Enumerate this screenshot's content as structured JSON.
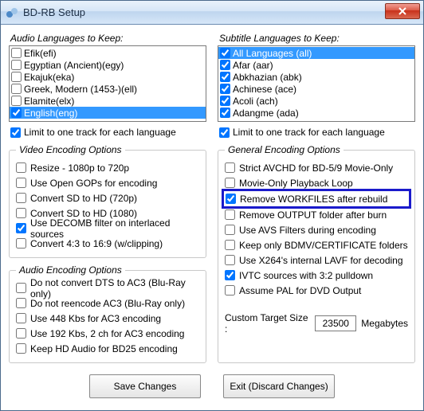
{
  "window": {
    "title": "BD-RB Setup"
  },
  "audio": {
    "section_label": "Audio Languages to Keep:",
    "items": [
      {
        "label": "Efik(efi)",
        "checked": false,
        "selected": false
      },
      {
        "label": "Egyptian (Ancient)(egy)",
        "checked": false,
        "selected": false
      },
      {
        "label": "Ekajuk(eka)",
        "checked": false,
        "selected": false
      },
      {
        "label": "Greek, Modern (1453-)(ell)",
        "checked": false,
        "selected": false
      },
      {
        "label": "Elamite(elx)",
        "checked": false,
        "selected": false
      },
      {
        "label": "English(eng)",
        "checked": true,
        "selected": true
      }
    ],
    "limit_label": "Limit to one track for each language",
    "limit_checked": true
  },
  "subtitle": {
    "section_label": "Subtitle Languages to Keep:",
    "items": [
      {
        "label": "All Languages (all)",
        "checked": true,
        "selected": true
      },
      {
        "label": "Afar (aar)",
        "checked": true,
        "selected": false
      },
      {
        "label": "Abkhazian (abk)",
        "checked": true,
        "selected": false
      },
      {
        "label": "Achinese (ace)",
        "checked": true,
        "selected": false
      },
      {
        "label": "Acoli (ach)",
        "checked": true,
        "selected": false
      },
      {
        "label": "Adangme (ada)",
        "checked": true,
        "selected": false
      }
    ],
    "limit_label": "Limit to one track for each language",
    "limit_checked": true
  },
  "video_opts": {
    "legend": "Video Encoding Options",
    "items": [
      {
        "label": "Resize  - 1080p to 720p",
        "checked": false
      },
      {
        "label": "Use Open GOPs for encoding",
        "checked": false
      },
      {
        "label": "Convert SD to HD (720p)",
        "checked": false
      },
      {
        "label": "Convert SD to HD (1080)",
        "checked": false
      },
      {
        "label": "Use DECOMB filter on interlaced sources",
        "checked": true
      },
      {
        "label": "Convert 4:3 to 16:9 (w/clipping)",
        "checked": false
      }
    ]
  },
  "audio_opts": {
    "legend": "Audio Encoding Options",
    "items": [
      {
        "label": "Do not convert DTS to AC3  (Blu-Ray only)",
        "checked": false
      },
      {
        "label": "Do not reencode AC3  (Blu-Ray only)",
        "checked": false
      },
      {
        "label": "Use 448 Kbs for AC3 encoding",
        "checked": false
      },
      {
        "label": "Use 192 Kbs, 2 ch for AC3 encoding",
        "checked": false
      },
      {
        "label": "Keep HD Audio for BD25 encoding",
        "checked": false
      }
    ]
  },
  "general_opts": {
    "legend": "General Encoding Options",
    "items": [
      {
        "label": "Strict AVCHD for BD-5/9 Movie-Only",
        "checked": false,
        "highlight": false
      },
      {
        "label": "Movie-Only Playback Loop",
        "checked": false,
        "highlight": false
      },
      {
        "label": "Remove WORKFILES after rebuild",
        "checked": true,
        "highlight": true
      },
      {
        "label": "Remove OUTPUT folder after burn",
        "checked": false,
        "highlight": false
      },
      {
        "label": "Use AVS Filters during encoding",
        "checked": false,
        "highlight": false
      },
      {
        "label": "Keep only BDMV/CERTIFICATE folders",
        "checked": false,
        "highlight": false
      },
      {
        "label": "Use X264's internal LAVF for decoding",
        "checked": false,
        "highlight": false
      },
      {
        "label": "IVTC sources with 3:2 pulldown",
        "checked": true,
        "highlight": false
      },
      {
        "label": "Assume PAL for DVD Output",
        "checked": false,
        "highlight": false
      }
    ],
    "custom_label": "Custom Target Size :",
    "custom_value": "23500",
    "custom_unit": "Megabytes"
  },
  "buttons": {
    "save": "Save Changes",
    "exit": "Exit (Discard Changes)"
  }
}
